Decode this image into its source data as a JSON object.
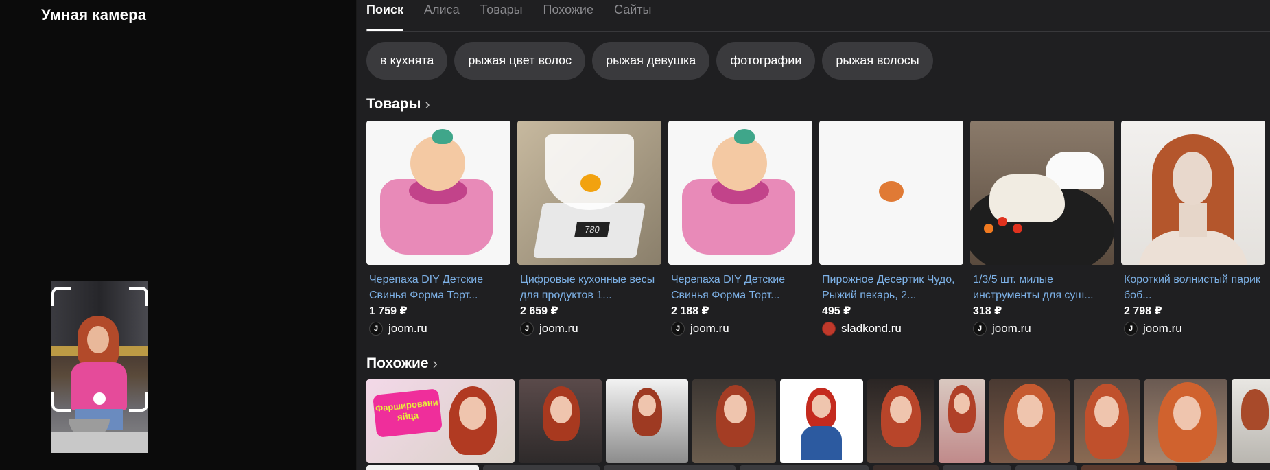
{
  "left": {
    "title": "Умная камера"
  },
  "tabs": [
    {
      "label": "Поиск",
      "active": true
    },
    {
      "label": "Алиса",
      "active": false
    },
    {
      "label": "Товары",
      "active": false
    },
    {
      "label": "Похожие",
      "active": false
    },
    {
      "label": "Сайты",
      "active": false
    }
  ],
  "chips": [
    "в кухнята",
    "рыжая цвет волос",
    "рыжая девушка",
    "фотографии",
    "рыжая волосы"
  ],
  "products_section": {
    "title": "Товары",
    "chevron_icon": "chevron-right-icon"
  },
  "products": [
    {
      "title": "Черепаха DIY Детские Свинья Форма Торт...",
      "price": "1 759 ₽",
      "store": "joom.ru",
      "store_icon": "joom-logo-icon"
    },
    {
      "title": "Цифровые кухонные весы для продуктов 1...",
      "price": "2 659 ₽",
      "store": "joom.ru",
      "store_icon": "joom-logo-icon",
      "display": "780"
    },
    {
      "title": "Черепаха DIY Детские Свинья Форма Торт...",
      "price": "2 188 ₽",
      "store": "joom.ru",
      "store_icon": "joom-logo-icon"
    },
    {
      "title": "Пирожное Десертик Чудо, Рыжий пекарь, 2...",
      "price": "495 ₽",
      "store": "sladkond.ru",
      "store_icon": "sladkond-logo-icon"
    },
    {
      "title": "1/3/5 шт. милые инструменты для суш...",
      "price": "318 ₽",
      "store": "joom.ru",
      "store_icon": "joom-logo-icon"
    },
    {
      "title": "Короткий волнистый парик боб...",
      "price": "2 798 ₽",
      "store": "joom.ru",
      "store_icon": "joom-logo-icon"
    }
  ],
  "similar_section": {
    "title": "Похожие",
    "chevron_icon": "chevron-right-icon"
  },
  "similar_banner": "Фаршировани яйца",
  "colors": {
    "background": "#1f1f21",
    "chip": "#3a3a3d",
    "link": "#7db1e6",
    "accent_hair": "#b24a2a"
  }
}
